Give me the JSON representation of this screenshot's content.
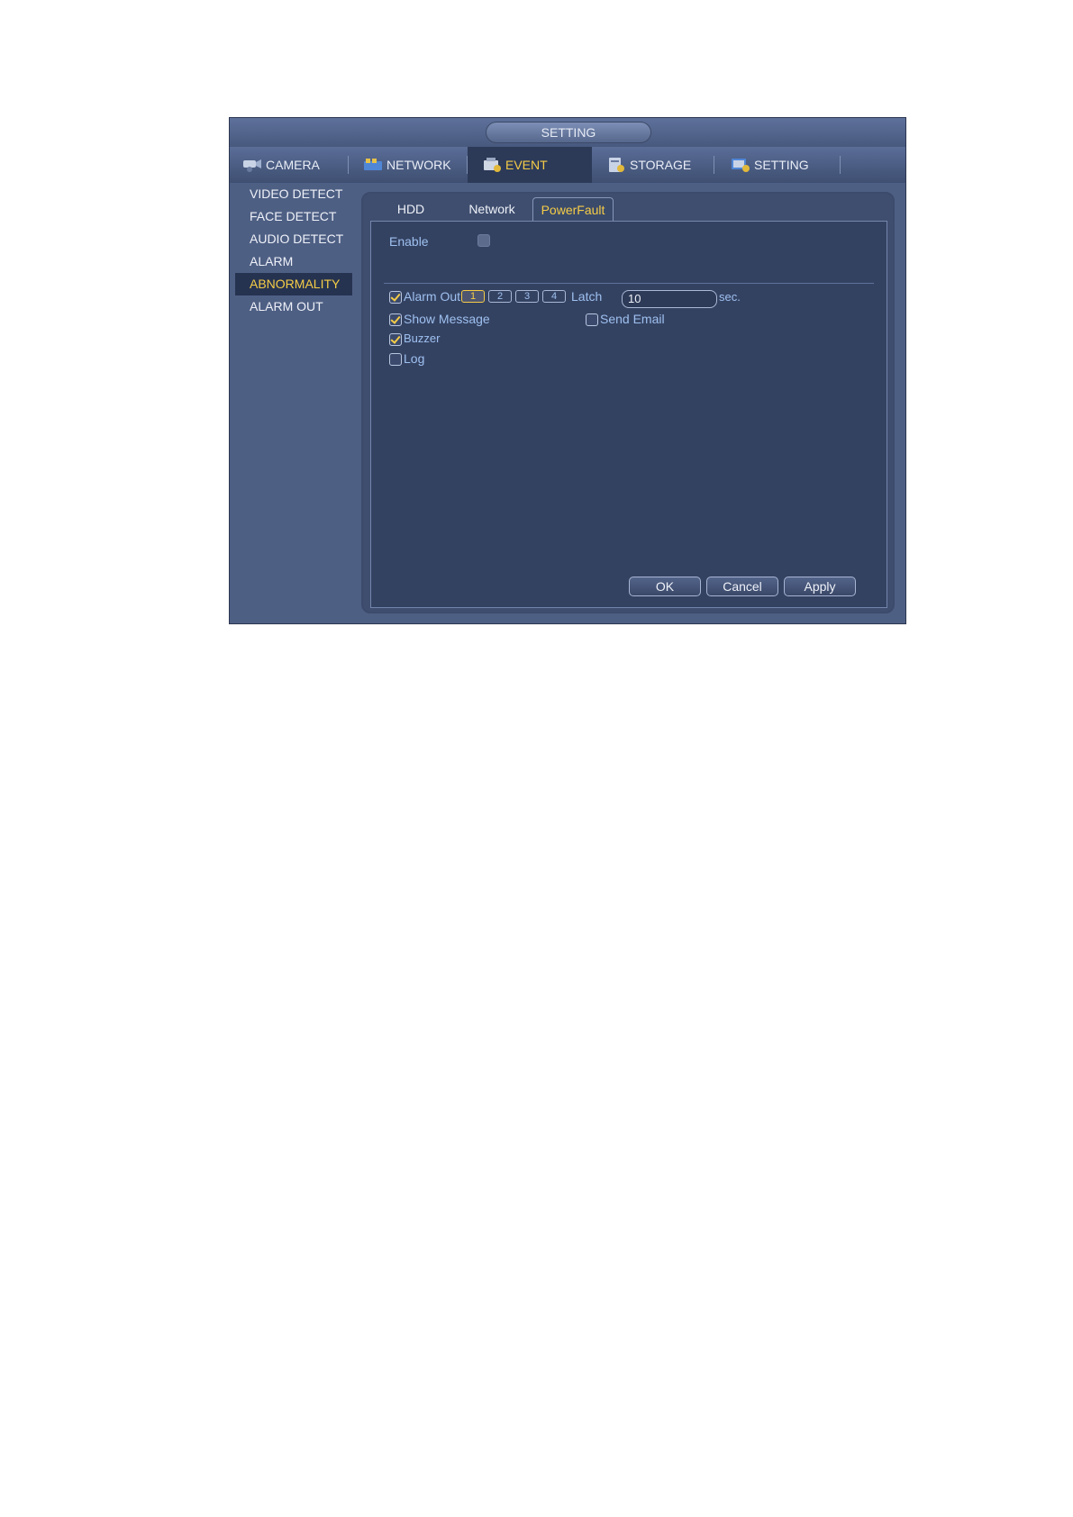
{
  "window": {
    "title": "SETTING"
  },
  "main_tabs": [
    {
      "label": "CAMERA",
      "icon": "camera-icon"
    },
    {
      "label": "NETWORK",
      "icon": "network-icon"
    },
    {
      "label": "EVENT",
      "icon": "event-icon",
      "active": true
    },
    {
      "label": "STORAGE",
      "icon": "storage-icon"
    },
    {
      "label": "SETTING",
      "icon": "setting-icon"
    }
  ],
  "sidebar": {
    "items": [
      {
        "label": "VIDEO DETECT"
      },
      {
        "label": "FACE DETECT"
      },
      {
        "label": "AUDIO DETECT"
      },
      {
        "label": "ALARM"
      },
      {
        "label": "ABNORMALITY",
        "active": true
      },
      {
        "label": "ALARM OUT"
      }
    ]
  },
  "sub_tabs": [
    {
      "label": "HDD"
    },
    {
      "label": "Network"
    },
    {
      "label": "PowerFault",
      "active": true
    }
  ],
  "form": {
    "enable": {
      "label": "Enable",
      "checked": false
    },
    "alarm_out": {
      "label": "Alarm Out",
      "checked": true,
      "channels": [
        "1",
        "2",
        "3",
        "4"
      ],
      "active_channel": "1"
    },
    "latch": {
      "label": "Latch",
      "value": "10",
      "unit": "sec."
    },
    "show_message": {
      "label": "Show Message",
      "checked": true
    },
    "send_email": {
      "label": "Send Email",
      "checked": false
    },
    "buzzer": {
      "label": "Buzzer",
      "checked": true
    },
    "log": {
      "label": "Log",
      "checked": false
    }
  },
  "buttons": {
    "ok": "OK",
    "cancel": "Cancel",
    "apply": "Apply"
  },
  "colors": {
    "accent": "#f5cc47",
    "label_blue": "#9ec0ef",
    "window_bg": "#4e5f84"
  }
}
